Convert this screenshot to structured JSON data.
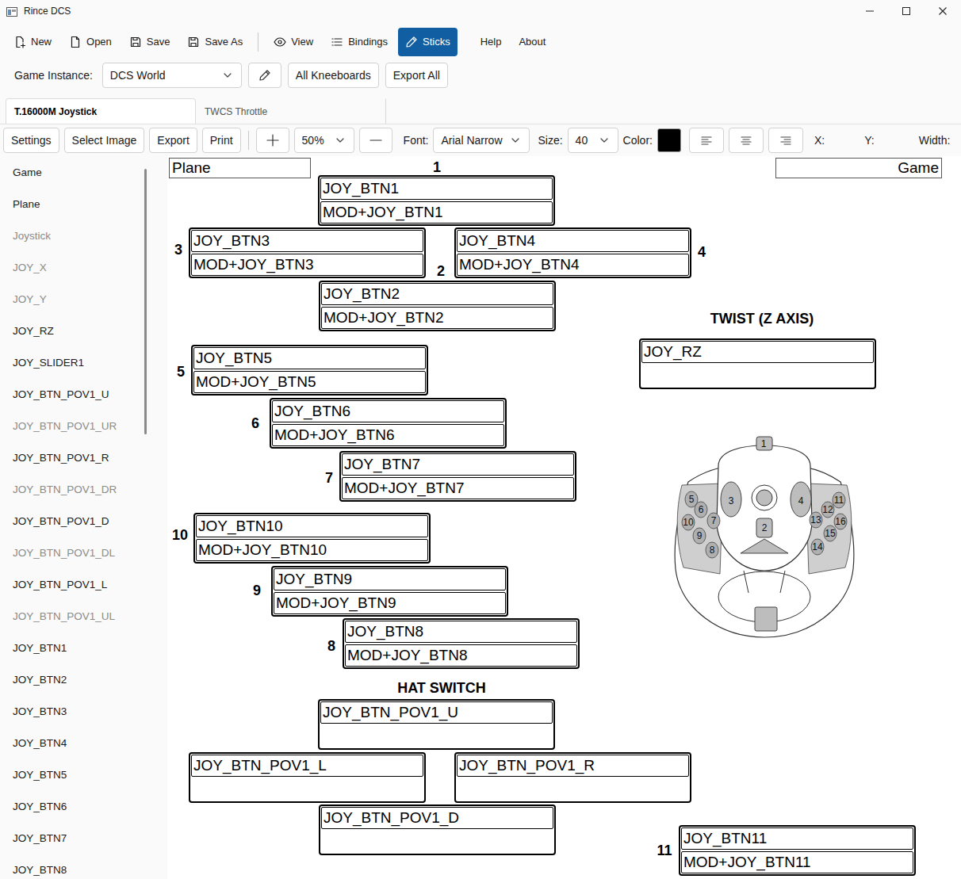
{
  "window": {
    "title": "Rince DCS"
  },
  "toolbar": {
    "items": [
      {
        "label": "New",
        "selected": false
      },
      {
        "label": "Open",
        "selected": false
      },
      {
        "label": "Save",
        "selected": false
      },
      {
        "label": "Save As",
        "selected": false
      },
      {
        "label": "View",
        "selected": false
      },
      {
        "label": "Bindings",
        "selected": false
      },
      {
        "label": "Sticks",
        "selected": true
      },
      {
        "label": "Help",
        "selected": false
      },
      {
        "label": "About",
        "selected": false
      }
    ]
  },
  "instance": {
    "label": "Game Instance:",
    "value": "DCS World",
    "buttons": [
      "All Kneeboards",
      "Export All"
    ]
  },
  "tabs": [
    {
      "label": "T.16000M Joystick",
      "selected": true
    },
    {
      "label": "TWCS Throttle",
      "selected": false
    }
  ],
  "editor_toolbar": {
    "buttons": [
      "Settings",
      "Select Image",
      "Export",
      "Print"
    ],
    "zoom": "50%",
    "font_label": "Font:",
    "font": "Arial Narrow",
    "size_label": "Size:",
    "size": "40",
    "color_label": "Color:",
    "color": "#000000",
    "x_label": "X:",
    "y_label": "Y:",
    "width_label": "Width:"
  },
  "sidebar": {
    "items": [
      {
        "label": "Game",
        "dimmed": false
      },
      {
        "label": "Plane",
        "dimmed": false
      },
      {
        "label": "Joystick",
        "dimmed": true
      },
      {
        "label": "JOY_X",
        "dimmed": true
      },
      {
        "label": "JOY_Y",
        "dimmed": true
      },
      {
        "label": "JOY_RZ",
        "dimmed": false
      },
      {
        "label": "JOY_SLIDER1",
        "dimmed": false
      },
      {
        "label": "JOY_BTN_POV1_U",
        "dimmed": false
      },
      {
        "label": "JOY_BTN_POV1_UR",
        "dimmed": true
      },
      {
        "label": "JOY_BTN_POV1_R",
        "dimmed": false
      },
      {
        "label": "JOY_BTN_POV1_DR",
        "dimmed": true
      },
      {
        "label": "JOY_BTN_POV1_D",
        "dimmed": false
      },
      {
        "label": "JOY_BTN_POV1_DL",
        "dimmed": true
      },
      {
        "label": "JOY_BTN_POV1_L",
        "dimmed": false
      },
      {
        "label": "JOY_BTN_POV1_UL",
        "dimmed": true
      },
      {
        "label": "JOY_BTN1",
        "dimmed": false
      },
      {
        "label": "JOY_BTN2",
        "dimmed": false
      },
      {
        "label": "JOY_BTN3",
        "dimmed": false
      },
      {
        "label": "JOY_BTN4",
        "dimmed": false
      },
      {
        "label": "JOY_BTN5",
        "dimmed": false
      },
      {
        "label": "JOY_BTN6",
        "dimmed": false
      },
      {
        "label": "JOY_BTN7",
        "dimmed": false
      },
      {
        "label": "JOY_BTN8",
        "dimmed": false
      }
    ]
  },
  "canvas": {
    "fields": [
      {
        "text": "Plane",
        "align": "left"
      },
      {
        "text": "Game",
        "align": "right"
      }
    ],
    "headings": [
      "HAT SWITCH",
      "TWIST (Z AXIS)"
    ],
    "bindings": [
      {
        "number": "1",
        "primary": "JOY_BTN1",
        "modified": "MOD+JOY_BTN1"
      },
      {
        "number": "3",
        "primary": "JOY_BTN3",
        "modified": "MOD+JOY_BTN3"
      },
      {
        "number": "4",
        "primary": "JOY_BTN4",
        "modified": "MOD+JOY_BTN4"
      },
      {
        "number": "2",
        "primary": "JOY_BTN2",
        "modified": "MOD+JOY_BTN2"
      },
      {
        "primary": "JOY_RZ",
        "modified": ""
      },
      {
        "number": "5",
        "primary": "JOY_BTN5",
        "modified": "MOD+JOY_BTN5"
      },
      {
        "number": "6",
        "primary": "JOY_BTN6",
        "modified": "MOD+JOY_BTN6"
      },
      {
        "number": "7",
        "primary": "JOY_BTN7",
        "modified": "MOD+JOY_BTN7"
      },
      {
        "number": "10",
        "primary": "JOY_BTN10",
        "modified": "MOD+JOY_BTN10"
      },
      {
        "number": "9",
        "primary": "JOY_BTN9",
        "modified": "MOD+JOY_BTN9"
      },
      {
        "number": "8",
        "primary": "JOY_BTN8",
        "modified": "MOD+JOY_BTN8"
      },
      {
        "primary": "JOY_BTN_POV1_U",
        "modified": ""
      },
      {
        "primary": "JOY_BTN_POV1_L",
        "modified": ""
      },
      {
        "primary": "JOY_BTN_POV1_R",
        "modified": ""
      },
      {
        "primary": "JOY_BTN_POV1_D",
        "modified": ""
      },
      {
        "number": "11",
        "primary": "JOY_BTN11",
        "modified": "MOD+JOY_BTN11"
      }
    ],
    "joystick_labels": [
      "1",
      "2",
      "3",
      "4",
      "5",
      "6",
      "7",
      "8",
      "9",
      "10",
      "11",
      "12",
      "13",
      "14",
      "15",
      "16"
    ]
  }
}
